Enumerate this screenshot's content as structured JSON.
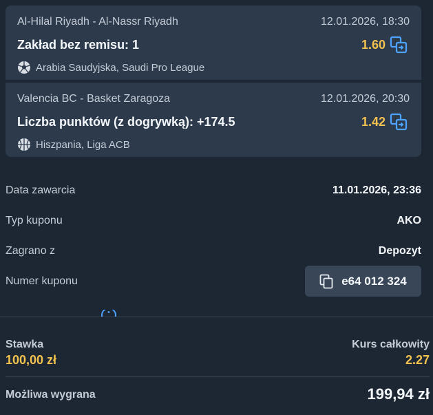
{
  "events": [
    {
      "teams": "Al-Hilal Riyadh - Al-Nassr Riyadh",
      "datetime": "12.01.2026, 18:30",
      "market": "Zakład bez remisu: 1",
      "odds": "1.60",
      "league": "Arabia Saudyjska, Saudi Pro League",
      "sport_icon": "soccer-ball-icon"
    },
    {
      "teams": "Valencia BC - Basket Zaragoza",
      "datetime": "12.01.2026, 20:30",
      "market": "Liczba punktów (z dogrywką): +174.5",
      "odds": "1.42",
      "league": "Hiszpania, Liga ACB",
      "sport_icon": "basketball-icon"
    }
  ],
  "details": {
    "date_label": "Data zawarcia",
    "date_value": "11.01.2026, 23:36",
    "type_label": "Typ kuponu",
    "type_value": "AKO",
    "played_label": "Zagrano z",
    "played_value": "Depozyt",
    "coupon_label": "Numer kuponu",
    "coupon_value": "e64 012 324"
  },
  "footer": {
    "stake_label": "Stawka",
    "stake_value": "100,00 zł",
    "total_odds_label": "Kurs całkowity",
    "total_odds_value": "2.27",
    "win_label": "Możliwa wygrana",
    "win_value": "199,94 zł"
  },
  "colors": {
    "background": "#1d2734",
    "card": "#2c3a4c",
    "accent_odds": "#f2c14e",
    "icon_blue": "#4da3ff"
  }
}
